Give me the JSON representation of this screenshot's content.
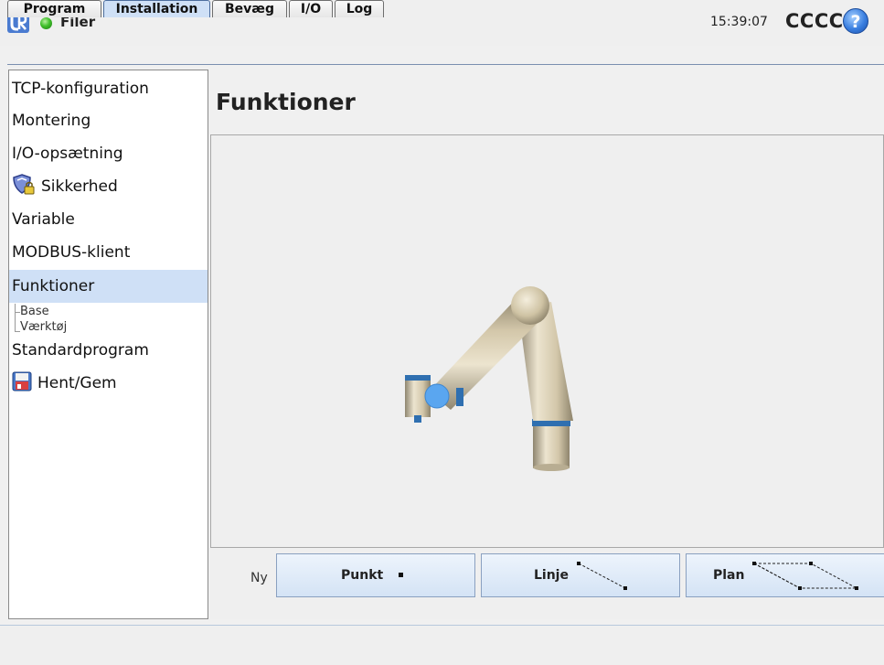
{
  "header": {
    "app_title": "Filer",
    "clock": "15:39:07",
    "robot_name": "CCCC",
    "help_label": "?"
  },
  "tabs": [
    {
      "label": "Program",
      "active": false
    },
    {
      "label": "Installation",
      "active": true
    },
    {
      "label": "Bevæg",
      "active": false
    },
    {
      "label": "I/O",
      "active": false
    },
    {
      "label": "Log",
      "active": false
    }
  ],
  "sidebar": {
    "items": [
      {
        "label": "TCP-konfiguration"
      },
      {
        "label": "Montering"
      },
      {
        "label": "I/O-opsætning"
      },
      {
        "label": "Sikkerhed",
        "icon": "shield-lock-icon"
      },
      {
        "label": "Variable"
      },
      {
        "label": "MODBUS-klient"
      },
      {
        "label": "Funktioner",
        "active": true
      },
      {
        "label": "Standardprogram"
      },
      {
        "label": "Hent/Gem",
        "icon": "floppy-disk-icon"
      }
    ],
    "sub_items": [
      {
        "label": "Base"
      },
      {
        "label": "Værktøj"
      }
    ]
  },
  "main": {
    "title": "Funktioner",
    "new_label": "Ny",
    "buttons": [
      {
        "label": "Punkt",
        "icon": "point-icon"
      },
      {
        "label": "Linje",
        "icon": "line-icon"
      },
      {
        "label": "Plan",
        "icon": "plane-icon"
      }
    ]
  },
  "colors": {
    "accent": "#cfe0f6",
    "robot_body": "#d8cdb4",
    "robot_ring": "#2f6fb0",
    "feature_marker": "#5aa6f0"
  }
}
